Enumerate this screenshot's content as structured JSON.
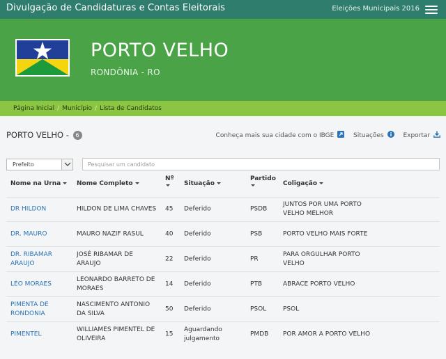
{
  "topbar": {
    "title": "Divulgação de Candidaturas e Contas Eleitorais",
    "election": "Eleições Municipais 2016"
  },
  "hero": {
    "city": "PORTO VELHO",
    "state": "RONDÔNIA - RO"
  },
  "breadcrumb": [
    "Página Inicial",
    "Município",
    "Lista de Candidatos"
  ],
  "heading": {
    "title": "PORTO VELHO -",
    "count": "6"
  },
  "actions": {
    "ibge": "Conheça mais sua cidade com o IBGE",
    "situacoes": "Situações",
    "exportar": "Exportar"
  },
  "filter": {
    "cargo_selected": "Prefeito",
    "search_placeholder": "Pesquisar um candidato"
  },
  "columns": {
    "urna": "Nome na Urna",
    "completo": "Nome Completo",
    "numero": "Nº",
    "situacao": "Situação",
    "partido": "Partido",
    "coligacao": "Coligação"
  },
  "rows": [
    {
      "urna": "DR HILDON",
      "completo": "HILDON DE LIMA CHAVES",
      "numero": "45",
      "situacao": "Deferido",
      "partido": "PSDB",
      "coligacao": "JUNTOS POR UMA PORTO VELHO MELHOR"
    },
    {
      "urna": "DR. MAURO",
      "completo": "MAURO NAZIF RASUL",
      "numero": "40",
      "situacao": "Deferido",
      "partido": "PSB",
      "coligacao": "PORTO VELHO MAIS FORTE"
    },
    {
      "urna": "DR. RIBAMAR ARAUJO",
      "completo": "JOSÉ RIBAMAR DE ARAUJO",
      "numero": "22",
      "situacao": "Deferido",
      "partido": "PR",
      "coligacao": "PARA ORGULHAR PORTO VELHO"
    },
    {
      "urna": "LÉO MORAES",
      "completo": "LEONARDO BARRETO DE MORAES",
      "numero": "14",
      "situacao": "Deferido",
      "partido": "PTB",
      "coligacao": "ABRACE PORTO VELHO"
    },
    {
      "urna": "PIMENTA DE RONDONIA",
      "completo": "NASCIMENTO ANTONIO DA SILVA",
      "numero": "50",
      "situacao": "Deferido",
      "partido": "PSOL",
      "coligacao": "PSOL"
    },
    {
      "urna": "PIMENTEL",
      "completo": "WILLIAMES PIMENTEL DE OLIVEIRA",
      "numero": "15",
      "situacao": "Aguardando julgamento",
      "partido": "PMDB",
      "coligacao": "POR AMOR A PORTO VELHO"
    }
  ],
  "colors": {
    "topbar": "#2f7d6c",
    "hero": "#4aa447",
    "breadcrumb": "#8bc541",
    "link": "#2a73b5"
  }
}
